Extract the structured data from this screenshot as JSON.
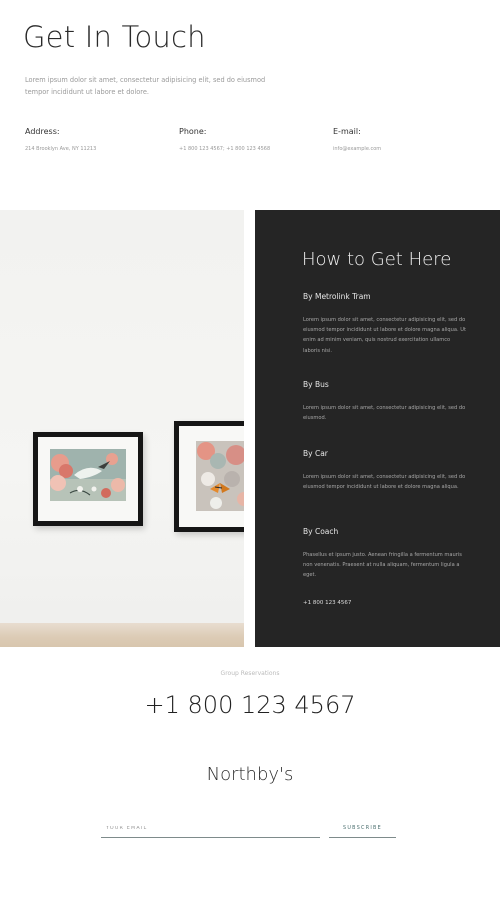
{
  "contact": {
    "title": "Get In Touch",
    "intro": "Lorem ipsum dolor sit amet, consectetur adipisicing elit, sed do eiusmod tempor incididunt ut labore et dolore.",
    "address_label": "Address:",
    "address_value": "214 Brooklyn Ave, NY 11213",
    "phone_label": "Phone:",
    "phone_value": "+1 800 123 4567; +1 800 123 4568",
    "email_label": "E-mail:",
    "email_value": "info@example.com"
  },
  "directions": {
    "title": "How to Get Here",
    "sections": [
      {
        "heading": "By Metrolink Tram",
        "body": "Lorem ipsum dolor sit amet, consectetur adipisicing elit, sed do eiusmod tempor incididunt ut labore et dolore magna aliqua. Ut enim ad minim veniam, quis nostrud exercitation ullamco laboris nisi."
      },
      {
        "heading": "By Bus",
        "body": "Lorem ipsum dolor sit amet, consectetur adipisicing elit, sed do eiusmod."
      },
      {
        "heading": "By Car",
        "body": "Lorem ipsum dolor sit amet, consectetur adipisicing elit, sed do eiusmod tempor incididunt ut labore et dolore magna aliqua."
      },
      {
        "heading": "By Coach",
        "body": "Phasellus et ipsum justo. Aenean fringilla a fermentum mauris non venenatis. Praesent at nulla aliquam, fermentum ligula a eget."
      }
    ],
    "phone": "+1 800 123 4567"
  },
  "reservations": {
    "label": "Group Reservations",
    "phone": "+1 800 123 4567"
  },
  "footer": {
    "brand": "Northby's",
    "email_placeholder": "YOUR EMAIL",
    "subscribe_label": "SUBSCRIBE"
  }
}
